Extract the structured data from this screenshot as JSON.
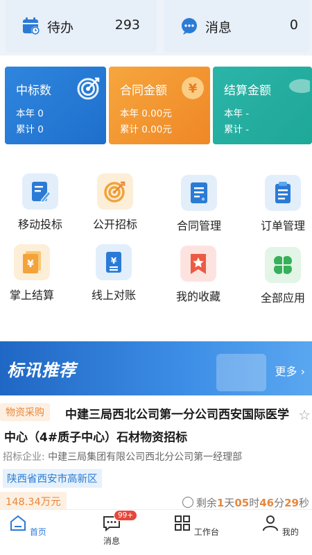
{
  "top_cards": {
    "todo": {
      "label": "待办",
      "count": "293"
    },
    "messages": {
      "label": "消息",
      "count": "0"
    }
  },
  "stats": [
    {
      "title": "中标数",
      "year_label": "本年",
      "year_value": "0",
      "total_label": "累计",
      "total_value": "0",
      "icon": "target-icon",
      "color": "#2f86dd"
    },
    {
      "title": "合同金额",
      "year_label": "本年",
      "year_value": "0.00元",
      "total_label": "累计",
      "total_value": "0.00元",
      "icon": "yen-coin-icon",
      "color": "#f6a63d"
    },
    {
      "title": "结算金额",
      "year_label": "本年",
      "year_value": "-",
      "total_label": "累计",
      "total_value": "-",
      "icon": "coin-icon",
      "color": "#2bb4a8"
    }
  ],
  "apps": [
    {
      "label": "移动投标",
      "icon": "edit-document-icon"
    },
    {
      "label": "公开招标",
      "icon": "target-icon"
    },
    {
      "label": "合同管理",
      "icon": "contract-icon"
    },
    {
      "label": "订单管理",
      "icon": "clipboard-icon"
    },
    {
      "label": "掌上结算",
      "icon": "yen-bill-icon"
    },
    {
      "label": "线上对账",
      "icon": "yen-document-icon"
    },
    {
      "label": "我的收藏",
      "icon": "star-bookmark-icon"
    },
    {
      "label": "全部应用",
      "icon": "clover-icon"
    }
  ],
  "banner": {
    "title": "标讯推荐",
    "more": "更多 ›"
  },
  "tender": {
    "category": "物资采购",
    "title": "中建三局西北公司第一分公司西安国际医学中心（4#质子中心）石材物资招标",
    "company_label": "招标企业:",
    "company": "中建三局集团有限公司西北分公司第一经理部",
    "location": "陕西省西安市高新区",
    "amount": "148.34万元",
    "countdown": {
      "prefix": "剩余",
      "days": "1",
      "d_unit": "天",
      "hours": "05",
      "h_unit": "时",
      "minutes": "46",
      "m_unit": "分",
      "seconds": "29",
      "s_unit": "秒"
    }
  },
  "nav": [
    {
      "label": "首页",
      "icon": "home-icon",
      "active": true
    },
    {
      "label": "消息",
      "icon": "chat-icon",
      "badge": "99+"
    },
    {
      "label": "工作台",
      "icon": "grid-icon"
    },
    {
      "label": "我的",
      "icon": "user-icon"
    }
  ],
  "colors": {
    "primary": "#2b7bd6",
    "accent": "#e8873a",
    "badge": "#e6483b"
  }
}
